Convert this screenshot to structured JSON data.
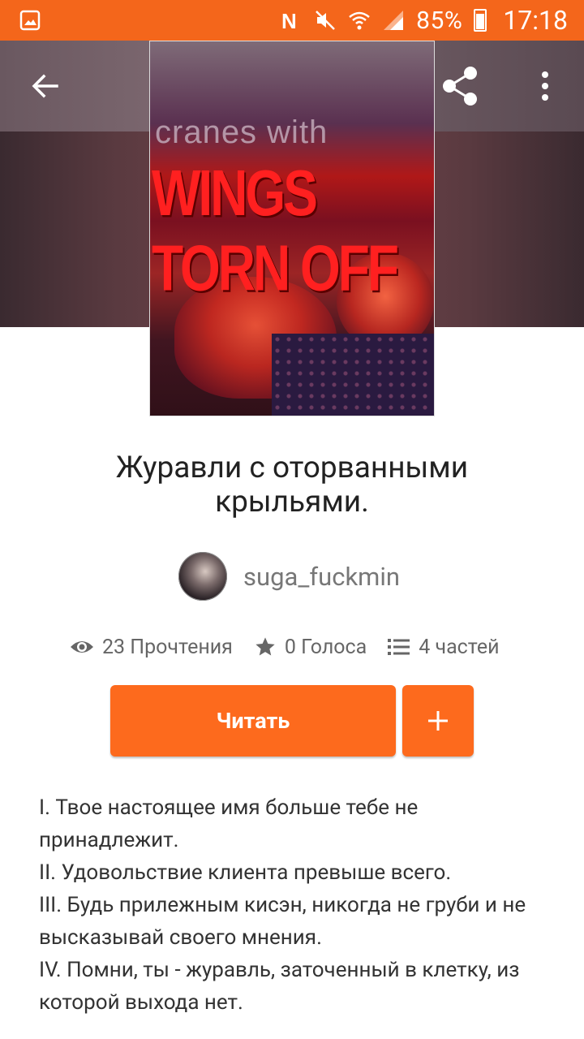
{
  "status_bar": {
    "battery_percent": "85%",
    "time": "17:18",
    "icons": [
      "gallery-icon",
      "nfc-icon",
      "mute-icon",
      "wifi-icon",
      "signal-icon",
      "battery-icon"
    ]
  },
  "header": {
    "icons": [
      "back-arrow-icon",
      "share-icon",
      "more-vert-icon"
    ]
  },
  "cover": {
    "subtitle_text": "cranes with",
    "title_text": "WINGS TORN OFF"
  },
  "story": {
    "title": "Журавли с оторванными крыльями.",
    "author": "suga_fuckmin",
    "stats": {
      "reads": "23 Прочтения",
      "votes": "0 Голоса",
      "parts": "4 частей"
    },
    "read_button": "Читать",
    "add_button": "+",
    "description": [
      "I. Твое настоящее имя больше тебе не принадлежит.",
      "II. Удовольствие клиента превыше всего.",
      "III. Будь прилежным кисэн, никогда не груби и не высказывай своего мнения.",
      "IV. Помни, ты - журавль, заточенный в клетку, из которой выхода нет."
    ]
  },
  "colors": {
    "accent": "#f4661b",
    "button": "#fd6a1d"
  }
}
